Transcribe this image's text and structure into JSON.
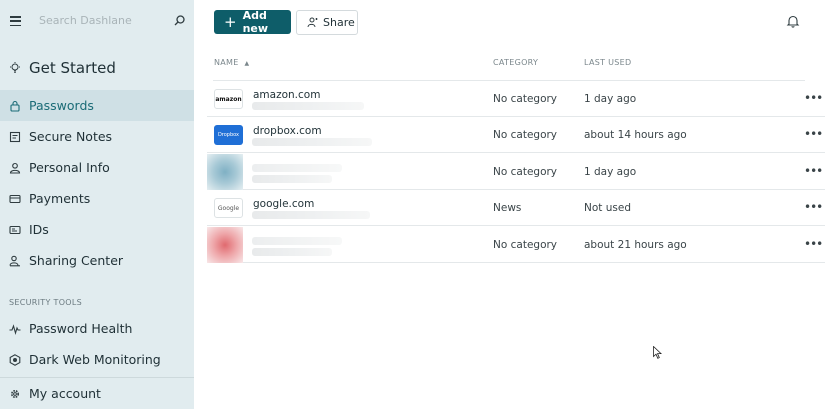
{
  "sidebar": {
    "search_placeholder": "Search Dashlane",
    "items": [
      {
        "label": "Get Started",
        "icon": "lightbulb-icon"
      },
      {
        "label": "Passwords",
        "icon": "lock-icon"
      },
      {
        "label": "Secure Notes",
        "icon": "note-icon"
      },
      {
        "label": "Personal Info",
        "icon": "person-icon"
      },
      {
        "label": "Payments",
        "icon": "card-icon"
      },
      {
        "label": "IDs",
        "icon": "id-card-icon"
      },
      {
        "label": "Sharing Center",
        "icon": "sharing-icon"
      }
    ],
    "section_label": "SECURITY TOOLS",
    "tools": [
      {
        "label": "Password Health",
        "icon": "pulse-icon"
      },
      {
        "label": "Dark Web Monitoring",
        "icon": "radar-icon"
      }
    ],
    "account": {
      "label": "My account",
      "icon": "gear-icon"
    }
  },
  "toolbar": {
    "add_label": "Add new",
    "share_label": "Share"
  },
  "table": {
    "columns": [
      "NAME",
      "CATEGORY",
      "LAST USED"
    ],
    "rows": [
      {
        "title": "amazon.com",
        "logo_text": "amazon",
        "category": "No category",
        "last_used": "1 day ago"
      },
      {
        "title": "dropbox.com",
        "logo_text": "Dropbox",
        "category": "No category",
        "last_used": "about 14 hours ago"
      },
      {
        "title": "",
        "logo_text": "",
        "category": "No category",
        "last_used": "1 day ago"
      },
      {
        "title": "google.com",
        "logo_text": "Google",
        "category": "News",
        "last_used": "Not used"
      },
      {
        "title": "",
        "logo_text": "",
        "category": "No category",
        "last_used": "about 21 hours ago"
      }
    ]
  },
  "colors": {
    "sidebar_bg": "#e1ecef",
    "active_bg": "#cfe0e5",
    "accent": "#0e5d69"
  }
}
